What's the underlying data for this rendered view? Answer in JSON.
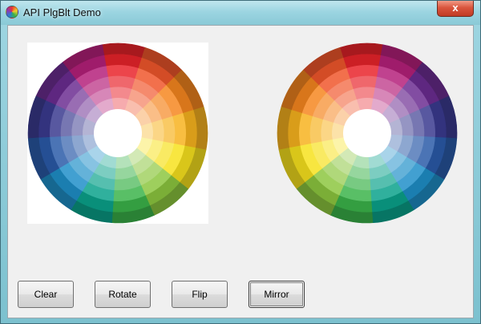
{
  "window": {
    "title": "API PlgBlt Demo",
    "close_label": "x"
  },
  "buttons": {
    "clear": "Clear",
    "rotate": "Rotate",
    "flip": "Flip",
    "mirror": "Mirror"
  },
  "wheel": {
    "hues": [
      "#e8232a",
      "#f0562b",
      "#f5861f",
      "#f7b21e",
      "#f7e11d",
      "#8cc63f",
      "#3bb34a",
      "#0aa28b",
      "#1f8fc8",
      "#2a5aa8",
      "#3a3a8f",
      "#6b2c91",
      "#b5207a"
    ],
    "bands": 6
  }
}
